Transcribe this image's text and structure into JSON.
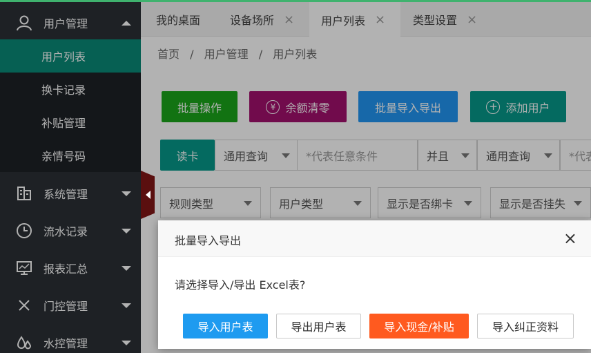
{
  "sidebar": {
    "groups": [
      {
        "label": "用户管理",
        "icon": "user-icon",
        "expanded": true
      },
      {
        "label": "系统管理",
        "icon": "building-icon"
      },
      {
        "label": "流水记录",
        "icon": "clock-icon"
      },
      {
        "label": "报表汇总",
        "icon": "chart-monitor-icon"
      },
      {
        "label": "门控管理",
        "icon": "cross-icon"
      },
      {
        "label": "水控管理",
        "icon": "water-drops-icon"
      }
    ],
    "sub_items": [
      {
        "label": "用户列表",
        "active": true
      },
      {
        "label": "换卡记录"
      },
      {
        "label": "补贴管理"
      },
      {
        "label": "亲情号码"
      }
    ]
  },
  "tabs": [
    {
      "label": "我的桌面"
    },
    {
      "label": "设备场所",
      "close": "×"
    },
    {
      "label": "用户列表",
      "close": "×",
      "active": true
    },
    {
      "label": "类型设置",
      "close": "×"
    }
  ],
  "breadcrumb": [
    "首页",
    "/",
    "用户管理",
    "/",
    "用户列表"
  ],
  "toolbar": {
    "batch_ops": "批量操作",
    "balance_clear": "余额清零",
    "balance_clear_icon": "¥",
    "batch_import_export": "批量导入导出",
    "add_user": "添加用户",
    "add_user_icon": "+"
  },
  "search": {
    "read_card": "读卡",
    "query_type_1": "通用查询",
    "condition_placeholder_1": "*代表任意条件",
    "logic": "并且",
    "query_type_2": "通用查询",
    "condition_placeholder_2": "*代表"
  },
  "filters": [
    "规则类型",
    "用户类型",
    "显示是否绑卡",
    "显示是否挂失"
  ],
  "dialog": {
    "title": "批量导入导出",
    "close": "×",
    "message": "请选择导入/导出 Excel表?",
    "buttons": [
      "导入用户表",
      "导出用户表",
      "导入现金/补贴",
      "导入纠正资料"
    ]
  },
  "colors": {
    "sidebar_bg": "#2b3036",
    "active_green": "#0a8a78",
    "btn_green": "#1aa51a",
    "btn_magenta": "#a3116e",
    "btn_blue": "#2196f3",
    "btn_teal": "#07988a",
    "dlg_blue": "#1e9bf0",
    "dlg_orange": "#ff5a1f"
  }
}
